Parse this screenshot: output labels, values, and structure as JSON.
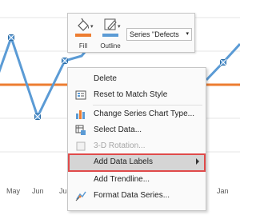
{
  "chart": {
    "months": [
      "May",
      "Jun",
      "Ju",
      "Jan"
    ],
    "series_color": "#5b9bd5",
    "target_color": "#ed7d31"
  },
  "mini_toolbar": {
    "fill_label": "Fill",
    "outline_label": "Outline",
    "series_select_value": "Series \"Defects",
    "fill_color": "#ed7d31",
    "outline_color": "#5b9bd5"
  },
  "context_menu": {
    "items": [
      {
        "label": "Delete",
        "icon": "none",
        "enabled": true
      },
      {
        "label": "Reset to Match Style",
        "icon": "reset-style-icon",
        "enabled": true
      },
      {
        "label": "Change Series Chart Type...",
        "icon": "chart-type-icon",
        "enabled": true
      },
      {
        "label": "Select Data...",
        "icon": "select-data-icon",
        "enabled": true
      },
      {
        "label": "3-D Rotation...",
        "icon": "rotation-3d-icon",
        "enabled": false
      },
      {
        "label": "Add Data Labels",
        "icon": "none",
        "enabled": true,
        "highlighted": true,
        "submenu": true
      },
      {
        "label": "Add Trendline...",
        "icon": "none",
        "enabled": true
      },
      {
        "label": "Format Data Series...",
        "icon": "format-series-icon",
        "enabled": true
      }
    ],
    "highlight_color": "#e04a4a"
  }
}
